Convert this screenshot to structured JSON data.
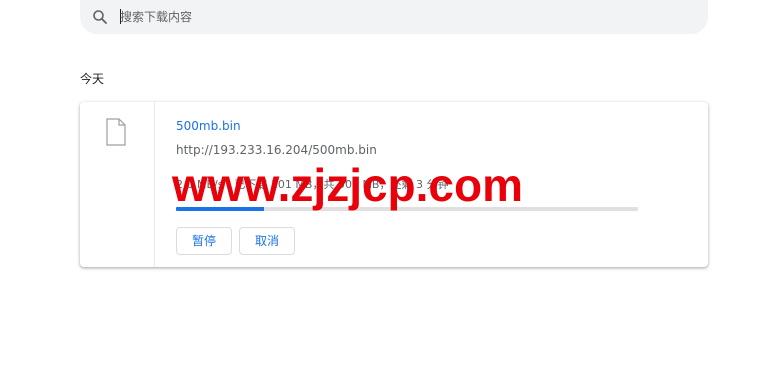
{
  "search": {
    "placeholder": "搜索下载内容",
    "icon": "search-icon"
  },
  "section": {
    "date_label": "今天"
  },
  "download": {
    "file_icon": "file-icon",
    "file_name": "500mb.bin",
    "url": "http://193.233.16.204/500mb.bin",
    "status": "2.0 MB/s - 已下载 101 MB，共 500 MB，还剩 3 分钟",
    "progress_fraction": 0.19,
    "pause_label": "暂停",
    "cancel_label": "取消"
  },
  "watermark": {
    "text": "www.zjzjcp.com"
  },
  "colors": {
    "accent": "#1a73e8",
    "watermark": "#e8000a",
    "search_bg": "#f1f3f4"
  }
}
